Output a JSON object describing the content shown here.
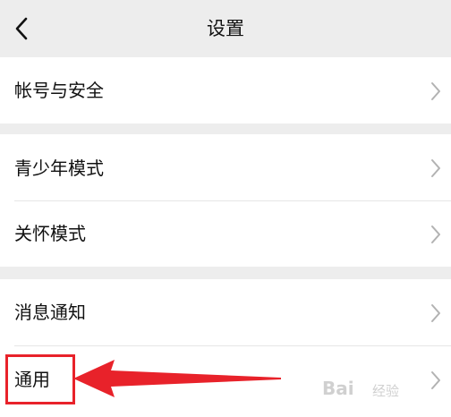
{
  "header": {
    "title": "设置",
    "back_icon": "chevron-left-icon"
  },
  "groups": [
    {
      "items": [
        {
          "label": "帐号与安全"
        }
      ]
    },
    {
      "items": [
        {
          "label": "青少年模式"
        },
        {
          "label": "关怀模式"
        }
      ]
    },
    {
      "items": [
        {
          "label": "消息通知"
        },
        {
          "label": "通用"
        }
      ]
    }
  ],
  "annotation": {
    "color": "#e8222a",
    "highlight_target": "通用"
  },
  "watermark": {
    "brand": "Bai",
    "sub": "经验"
  },
  "colors": {
    "background": "#ededed",
    "card": "#ffffff",
    "text": "#111111",
    "chevron": "#b2b2b2"
  }
}
